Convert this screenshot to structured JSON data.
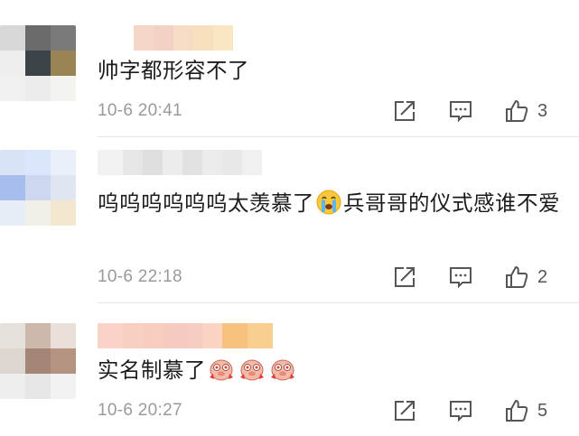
{
  "comments": [
    {
      "text_parts": [
        "帅字都形容不了"
      ],
      "timestamp": "10-6 20:41",
      "like_count": "3",
      "avatar_colors": [
        "#d7d7d7",
        "#6b6b6b",
        "#7a7a7a",
        "#eeeeee",
        "#3c4348",
        "#9a8454",
        "#f0f0f0",
        "#ececec",
        "#f3f3f0"
      ],
      "username_colors": [
        "#ffffff",
        "#f6d6c7",
        "#f4d2c3",
        "#f7dcc4",
        "#f8dfbf",
        "#fbe6c3"
      ]
    },
    {
      "text_parts": [
        "呜呜呜呜呜呜太羡慕了",
        "兵哥哥的仪式感谁不爱"
      ],
      "timestamp": "10-6 22:18",
      "like_count": "2",
      "emoji": [
        "crying-face"
      ],
      "avatar_colors": [
        "#d8e3f6",
        "#d9e6fb",
        "#eaf0f8",
        "#a7bdee",
        "#cdd7f0",
        "#dfe6f2",
        "#e7edf7",
        "#f2efe9",
        "#f3e7cf"
      ],
      "username_colors": [
        "#f2f2f2",
        "#e6e6e6",
        "#dfdfdf",
        "#ececec",
        "#e2e2e2",
        "#ebebeb",
        "#e8e8e8",
        "#f0f0f0"
      ]
    },
    {
      "text_parts": [
        "实名制慕了"
      ],
      "timestamp": "10-6 20:27",
      "like_count": "5",
      "emoji": [
        "piglet",
        "piglet",
        "piglet"
      ],
      "avatar_colors": [
        "#e6e0dc",
        "#cdb9ac",
        "#e8dfd9",
        "#ddd5d0",
        "#a38676",
        "#b49480",
        "#eeeeee",
        "#e6e6e6",
        "#f2f2f2"
      ],
      "username_colors": [
        "#f9d3c5",
        "#f8d0c2",
        "#f7cdbf",
        "#f6cabe",
        "#f7ccc0",
        "#f9d4c2",
        "#f6c37f",
        "#f8cf8e"
      ]
    }
  ]
}
